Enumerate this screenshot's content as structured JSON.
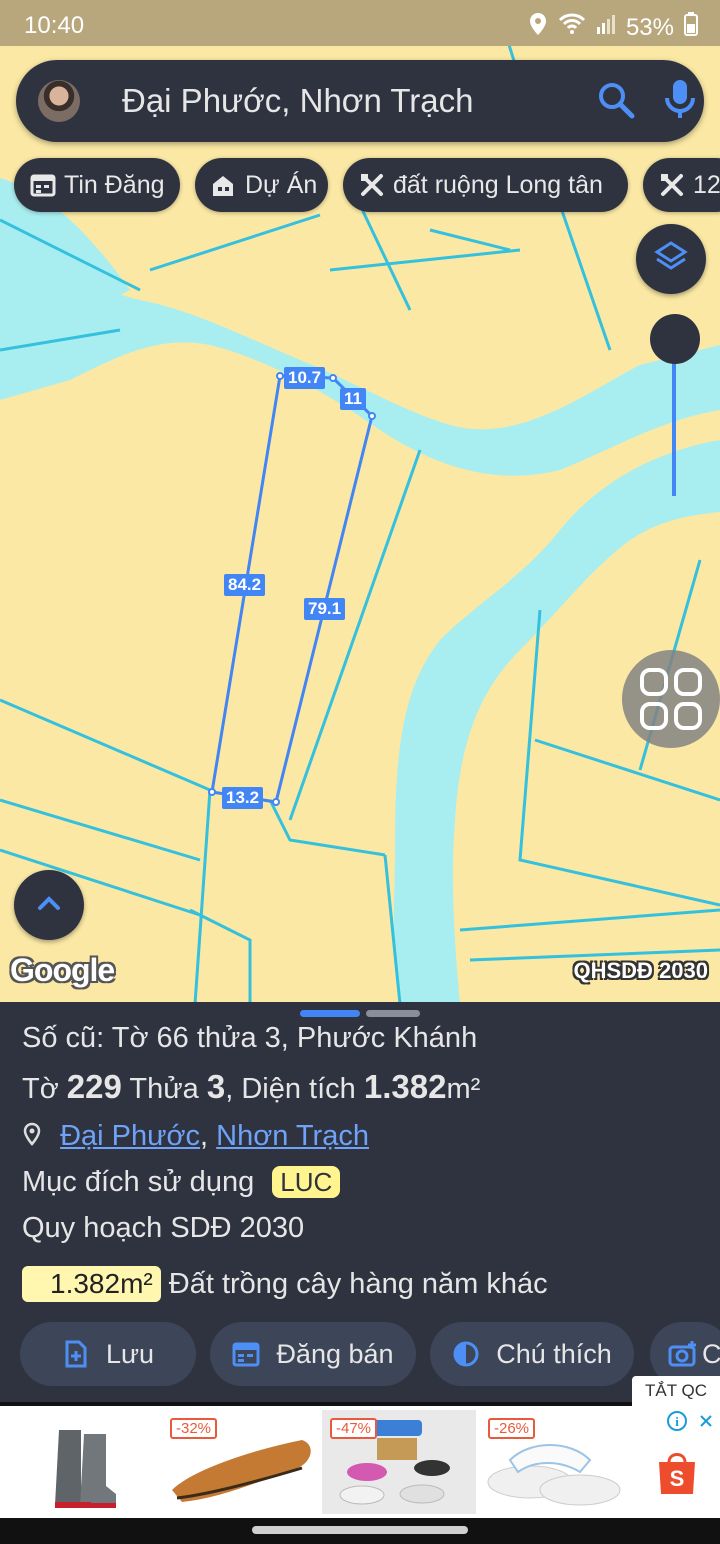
{
  "status_bar": {
    "time": "10:40",
    "battery": "53%",
    "icons": [
      "location-icon",
      "wifi-icon",
      "signal-icon",
      "battery-icon"
    ]
  },
  "search": {
    "query": "Đại Phước, Nhơn Trạch",
    "icons": [
      "avatar",
      "search-icon",
      "mic-icon"
    ]
  },
  "chips": [
    {
      "label": "Tin Đăng",
      "icon": "calendar-icon"
    },
    {
      "label": "Dự Án",
      "icon": "building-icon"
    },
    {
      "label": "đất ruộng Long tân",
      "icon": "tools-icon"
    },
    {
      "label": "12",
      "icon": "tools-icon"
    }
  ],
  "map": {
    "edge_labels": {
      "top": "10.7",
      "top_right": "11",
      "left": "84.2",
      "right": "79.1",
      "bottom": "13.2"
    },
    "attribution": "Google",
    "layer_label": "QHSDĐ 2030"
  },
  "sheet": {
    "old_parcel": "Số cũ: Tờ 66 thửa 3, Phước Khánh",
    "sheet_prefix": "Tờ",
    "sheet_no": "229",
    "parcel_prefix": "Thửa",
    "parcel_no": "3",
    "area_prefix": ", Diện tích",
    "area": "1.382",
    "area_unit": "m²",
    "location_commune": "Đại Phước",
    "location_separator": ", ",
    "location_district": "Nhơn Trạch",
    "purpose_label": "Mục đích sử dụng",
    "purpose_code": "LUC",
    "planning_label": "Quy hoạch SDĐ 2030",
    "planning_area": "1.382m²",
    "planning_type": "Đất trồng cây hàng năm khác"
  },
  "actions": [
    {
      "label": "Lưu",
      "icon": "add-doc-icon"
    },
    {
      "label": "Đăng bán",
      "icon": "calendar-icon"
    },
    {
      "label": "Chú thích",
      "icon": "contrast-icon"
    },
    {
      "label": "C",
      "icon": "camera-plus-icon"
    }
  ],
  "ad": {
    "close_label": "TẮT QC",
    "discounts": [
      "-32%",
      "-47%",
      "-26%"
    ],
    "store_badge": "S",
    "info_icon": "i",
    "colors": {
      "discount": "#e85a3c",
      "store": "#ee4d2d"
    }
  },
  "colors": {
    "land": "#fae8a4",
    "water": "#a8eef0",
    "lines": "#35c0dd",
    "accent": "#4285f4",
    "surface": "#2f3340"
  }
}
